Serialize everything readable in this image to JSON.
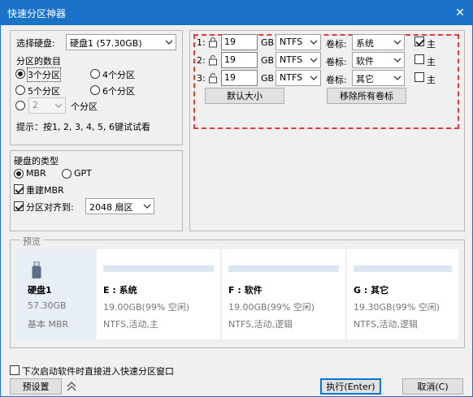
{
  "window": {
    "title": "快速分区神器"
  },
  "disk_select": {
    "label": "选择硬盘:",
    "value": "硬盘1 (57.30GB)"
  },
  "partition_count": {
    "title": "分区的数目",
    "options": [
      "3个分区",
      "4个分区",
      "5个分区",
      "6个分区"
    ],
    "custom_value": "2",
    "custom_label": "个分区",
    "hint": "提示：按1, 2, 3, 4, 5, 6键试试看"
  },
  "disk_type": {
    "title": "硬盘的类型",
    "mbr": "MBR",
    "gpt": "GPT",
    "rebuild_mbr": "重建MBR",
    "align_label": "分区对齐到:",
    "align_value": "2048 扇区"
  },
  "partitions": [
    {
      "index": "1:",
      "size": "19",
      "unit": "GB",
      "fs": "NTFS",
      "label_title": "卷标:",
      "label": "系统",
      "primary": "主"
    },
    {
      "index": "2:",
      "size": "19",
      "unit": "GB",
      "fs": "NTFS",
      "label_title": "卷标:",
      "label": "软件",
      "primary": "主"
    },
    {
      "index": "3:",
      "size": "19",
      "unit": "GB",
      "fs": "NTFS",
      "label_title": "卷标:",
      "label": "其它",
      "primary": "主"
    }
  ],
  "partition_buttons": {
    "default_size": "默认大小",
    "remove_labels": "移除所有卷标"
  },
  "preview": {
    "title": "预览",
    "disk": {
      "name": "硬盘1",
      "size": "57.30GB",
      "type": "基本 MBR"
    },
    "cards": [
      {
        "name": "E : 系统",
        "capacity": "19.00GB(99% 空闲)",
        "fs": "NTFS,活动,主"
      },
      {
        "name": "F : 软件",
        "capacity": "19.00GB(99% 空闲)",
        "fs": "NTFS,活动,逻辑"
      },
      {
        "name": "G : 其它",
        "capacity": "19.30GB(99% 空闲)",
        "fs": "NTFS,活动,逻辑"
      }
    ]
  },
  "footer": {
    "startup_checkbox": "下次启动软件时直接进入快速分区窗口",
    "preset": "预设置",
    "execute": "执行(Enter)",
    "cancel": "取消(C)"
  },
  "colors": {
    "titlebar": "#1a73c8",
    "highlight": "#e53935",
    "preview_disk_bg": "#e8eef6"
  }
}
